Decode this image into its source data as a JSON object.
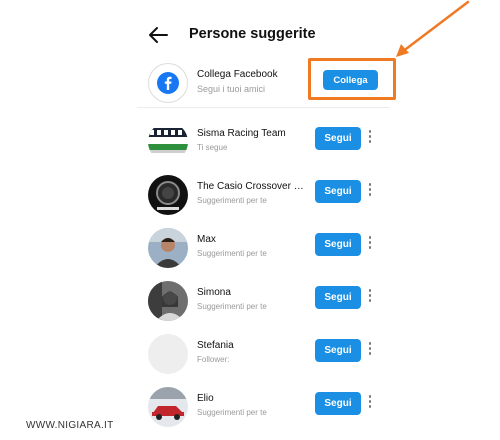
{
  "header": {
    "title": "Persone suggerite"
  },
  "connect_card": {
    "title": "Collega Facebook",
    "subtitle": "Segui i tuoi amici",
    "button_label": "Collega"
  },
  "suggestions": [
    {
      "name": "Sisma Racing Team",
      "subtitle": "Ti segue",
      "button_label": "Segui"
    },
    {
      "name": "The Casio Crossover Pl...",
      "subtitle": "Suggerimenti per te",
      "button_label": "Segui"
    },
    {
      "name": "Max",
      "subtitle": "Suggerimenti per te",
      "button_label": "Segui"
    },
    {
      "name": "Simona",
      "subtitle": "Suggerimenti per te",
      "button_label": "Segui"
    },
    {
      "name": "Stefania",
      "subtitle": "Follower:",
      "button_label": "Segui"
    },
    {
      "name": "Elio",
      "subtitle": "Suggerimenti per te",
      "button_label": "Segui"
    }
  ],
  "watermark": "WWW.NIGIARA.IT",
  "colors": {
    "accent": "#1a8fe3",
    "highlight": "#f07a24",
    "facebook": "#1877f2"
  }
}
